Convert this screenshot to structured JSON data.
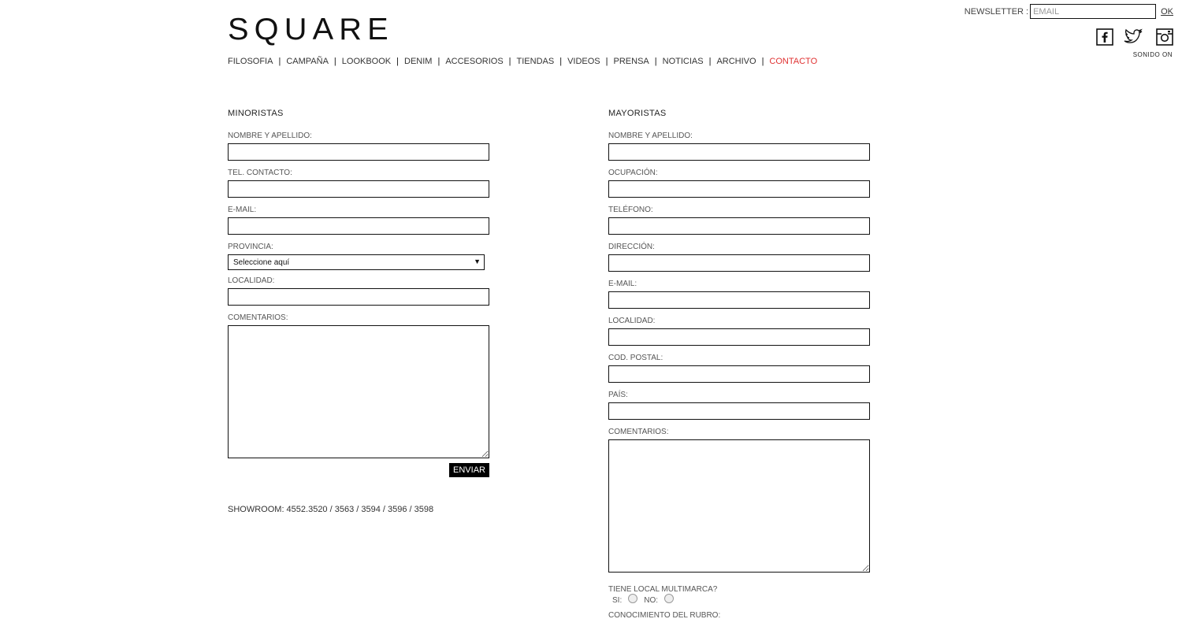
{
  "brand": {
    "logo": "SQUARE"
  },
  "nav": {
    "items": [
      "FILOSOFIA",
      "CAMPAÑA",
      "LOOKBOOK",
      "DENIM",
      "ACCESORIOS",
      "TIENDAS",
      "VIDEOS",
      "PRENSA",
      "NOTICIAS",
      "ARCHIVO",
      "CONTACTO"
    ],
    "active": "CONTACTO",
    "separator": "|"
  },
  "newsletter": {
    "label": "NEWSLETTER :",
    "placeholder": "EMAIL",
    "ok": "OK"
  },
  "social": {
    "icons": [
      "facebook-icon",
      "twitter-icon",
      "instagram-icon"
    ],
    "sound": "SONIDO ON"
  },
  "minoristas": {
    "title": "MINORISTAS",
    "fields": {
      "nombre": "NOMBRE Y APELLIDO:",
      "tel": "TEL. CONTACTO:",
      "email": "E-MAIL:",
      "provincia": "PROVINCIA:",
      "provincia_value": "Seleccione aquí",
      "localidad": "LOCALIDAD:",
      "comentarios": "COMENTARIOS:"
    },
    "submit": "ENVIAR",
    "showroom": "SHOWROOM: 4552.3520 / 3563 / 3594 / 3596 / 3598"
  },
  "mayoristas": {
    "title": "MAYORISTAS",
    "fields": {
      "nombre": "NOMBRE Y APELLIDO:",
      "ocupacion": "OCUPACIÓN:",
      "telefono": "TELÉFONO:",
      "direccion": "DIRECCIÓN:",
      "email": "E-MAIL:",
      "localidad": "LOCALIDAD:",
      "cod_postal": "COD. POSTAL:",
      "pais": "PAÍS:",
      "comentarios": "COMENTARIOS:"
    },
    "multimarca": {
      "question": "TIENE LOCAL MULTIMARCA?",
      "yes": "SI:",
      "no": "NO:"
    },
    "conocimiento": "CONOCIMIENTO DEL RUBRO:"
  }
}
